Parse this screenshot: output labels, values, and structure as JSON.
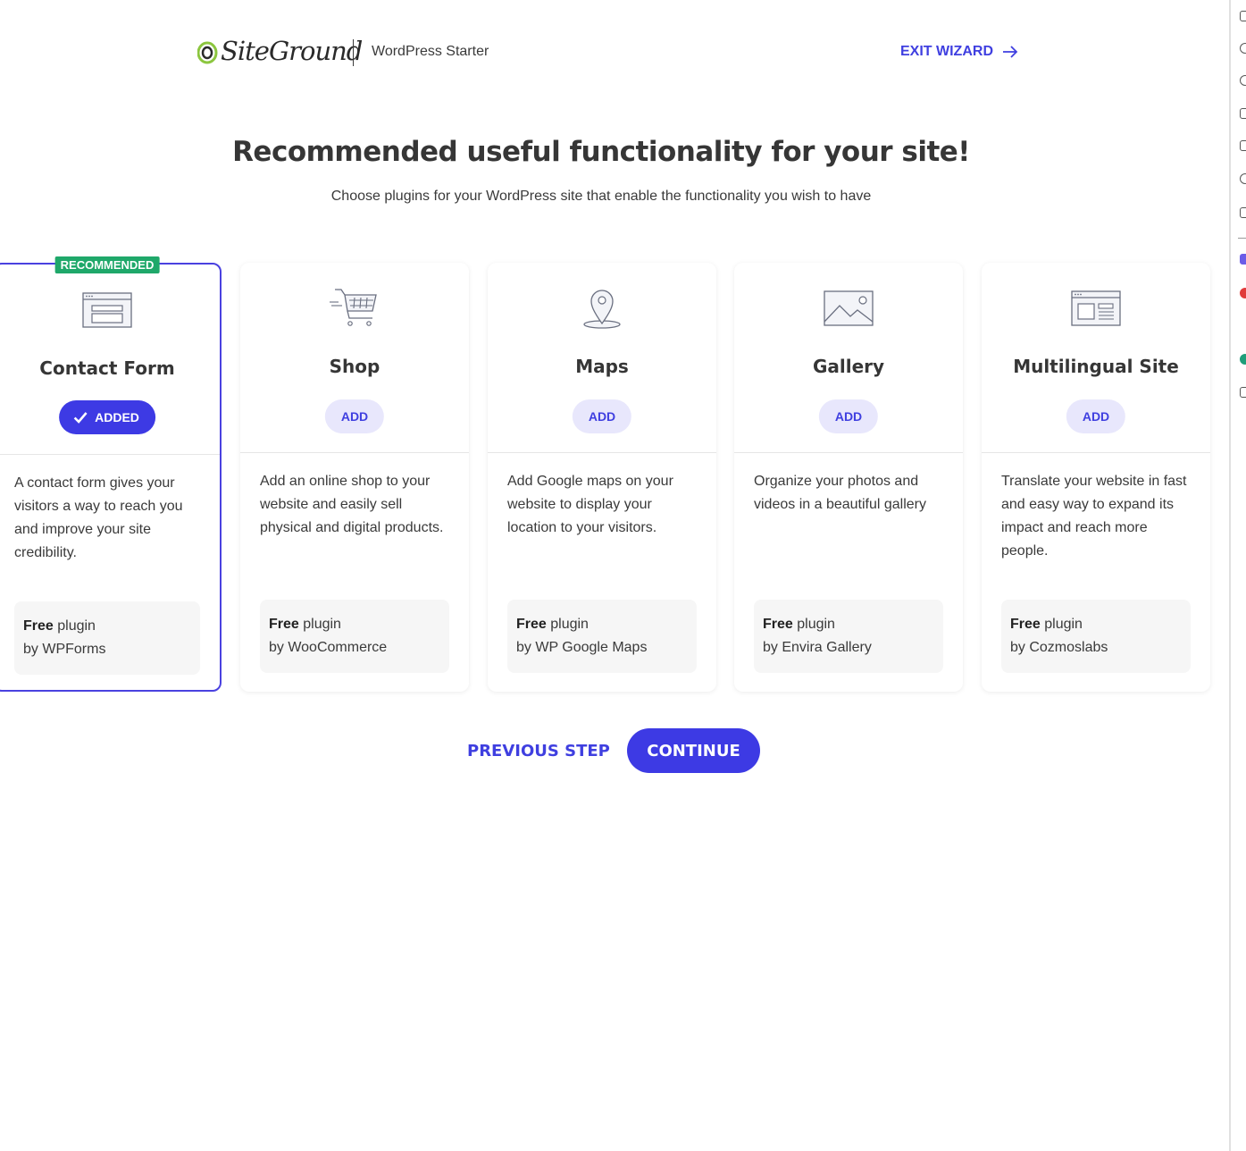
{
  "header": {
    "logo_text": "SiteGround",
    "product_name": "WordPress Starter",
    "exit_label": "EXIT WIZARD"
  },
  "main": {
    "title": "Recommended useful functionality for your site!",
    "subtitle": "Choose plugins for your WordPress site that enable the functionality you wish to have"
  },
  "cards": [
    {
      "badge": "RECOMMENDED",
      "title": "Contact Form",
      "button": "ADDED",
      "description": "A contact form gives your visitors a way to reach you and improve your site credibility.",
      "free": "Free",
      "plugin": "plugin",
      "by": "by WPForms",
      "icon": "form-window-icon"
    },
    {
      "title": "Shop",
      "button": "ADD",
      "description": "Add an online shop to your website and easily sell physical and digital products.",
      "free": "Free",
      "plugin": "plugin",
      "by": "by WooCommerce",
      "icon": "shopping-cart-icon"
    },
    {
      "title": "Maps",
      "button": "ADD",
      "description": "Add Google maps on your website to display your location to your visitors.",
      "free": "Free",
      "plugin": "plugin",
      "by": "by WP Google Maps",
      "icon": "map-pin-icon"
    },
    {
      "title": "Gallery",
      "button": "ADD",
      "description": "Organize your photos and videos in a beautiful gallery",
      "free": "Free",
      "plugin": "plugin",
      "by": "by Envira Gallery",
      "icon": "image-gallery-icon"
    },
    {
      "title": "Multilingual Site",
      "button": "ADD",
      "description": "Translate your website in fast and easy way to expand its impact and reach more people.",
      "free": "Free",
      "plugin": "plugin",
      "by": "by Cozmoslabs",
      "icon": "multilingual-window-icon"
    }
  ],
  "footer": {
    "previous_label": "PREVIOUS STEP",
    "continue_label": "CONTINUE"
  },
  "colors": {
    "accent": "#3d3ae4",
    "badge_green": "#1fa86a",
    "add_button_bg": "#e8e7fc"
  }
}
